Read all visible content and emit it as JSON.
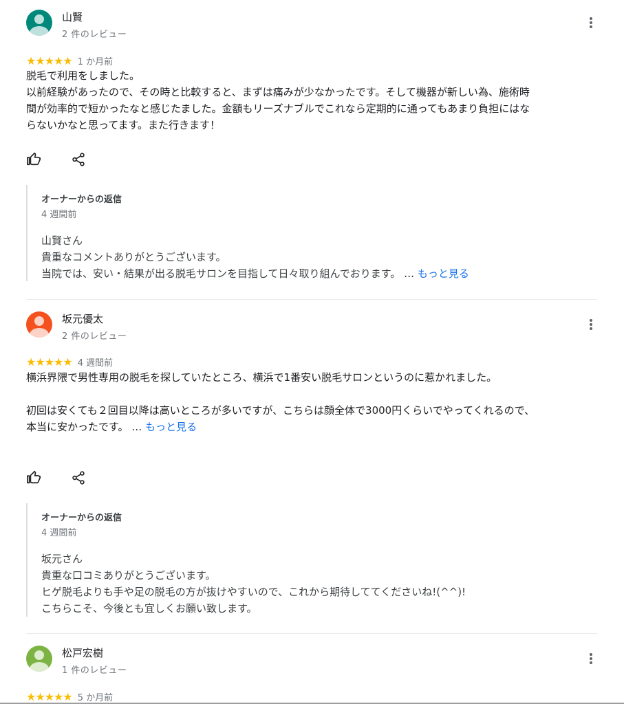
{
  "reviews": [
    {
      "name": "山賢",
      "review_count": "2 件のレビュー",
      "avatar_color": "#00897b",
      "stars": "★★★★★",
      "date": "1 か月前",
      "text": "脱毛で利用をしました。\n以前経験があったので、その時と比較すると、まずは痛みが少なかったです。そして機器が新しい為、施術時間が効率的で短かったなと感じたました。金額もリーズナブルでこれなら定期的に通ってもあまり負担にはならないかなと思ってます。また行きます！",
      "owner_title": "オーナーからの返信",
      "owner_date": "4 週間前",
      "owner_text": "山賢さん\n貴重なコメントありがとうございます。\n当院では、安い・結果が出る脱毛サロンを目指して日々取り組んでおります。",
      "owner_ellipsis": " … ",
      "owner_more": "もっと見る"
    },
    {
      "name": "坂元優太",
      "review_count": "2 件のレビュー",
      "avatar_color": "#f4511e",
      "stars": "★★★★★",
      "date": "4 週間前",
      "text": "横浜界隈で男性専用の脱毛を探していたところ、横浜で1番安い脱毛サロンというのに惹かれました。\n\n初回は安くても２回目以降は高いところが多いですが、こちらは顔全体で3000円くらいでやってくれるので、本当に安かったです。",
      "text_ellipsis": " … ",
      "text_more": "もっと見る",
      "owner_title": "オーナーからの返信",
      "owner_date": "4 週間前",
      "owner_text": "坂元さん\n貴重な口コミありがとうございます。\nヒゲ脱毛よりも手や足の脱毛の方が抜けやすいので、これから期待しててくださいね!(^^)!\nこちらこそ、今後とも宜しくお願い致します。"
    },
    {
      "name": "松戸宏樹",
      "review_count": "1 件のレビュー",
      "avatar_color": "#7cb342",
      "stars": "★★★★★",
      "date": "5 か月前"
    }
  ],
  "icons": {
    "like": "thumbs-up-icon",
    "share": "share-icon",
    "more": "more-vert-icon"
  }
}
